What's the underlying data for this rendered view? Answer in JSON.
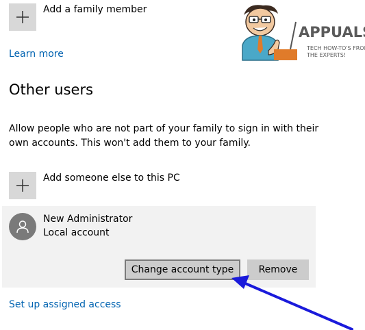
{
  "family": {
    "add_label": "Add a family member",
    "learn_more": "Learn more"
  },
  "other_users": {
    "heading": "Other users",
    "description": "Allow people who are not part of your family to sign in with their own accounts. This won't add them to your family.",
    "add_label": "Add someone else to this PC"
  },
  "account": {
    "name": "New Administrator",
    "type": "Local account",
    "change_button": "Change account type",
    "remove_button": "Remove"
  },
  "assigned_access_link": "Set up assigned access",
  "watermark": {
    "brand": "APPUALS",
    "tagline_1": "TECH HOW-TO'S FROM",
    "tagline_2": "THE EXPERTS!"
  },
  "colors": {
    "link": "#0063b1",
    "annotation_arrow": "#1a1adb",
    "tile": "#d8d8d8",
    "panel": "#f2f2f2",
    "avatar": "#7a7a7a"
  },
  "icons": [
    "plus-icon",
    "user-avatar-icon",
    "arrow-annotation"
  ]
}
